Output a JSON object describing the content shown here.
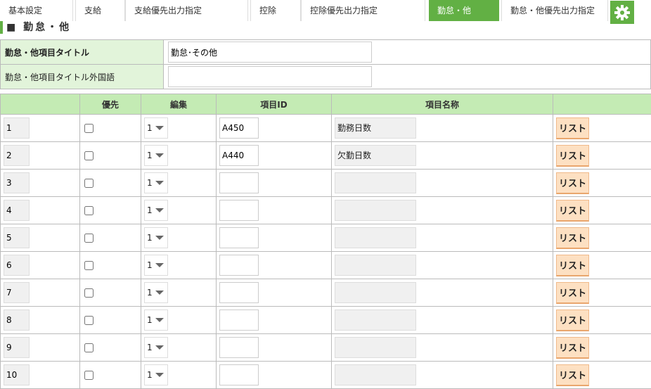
{
  "tabs": [
    "基本設定",
    "支給",
    "支給優先出力指定",
    "控除",
    "控除優先出力指定",
    "勤怠・他",
    "勤怠・他優先出力指定"
  ],
  "active_tab": 5,
  "section_title": "■ 勤怠・他",
  "info": {
    "title_label": "勤怠・他項目タイトル",
    "title_value": "勤怠･その他",
    "foreign_label": "勤怠・他項目タイトル外国語",
    "foreign_value": ""
  },
  "columns": [
    "",
    "優先",
    "編集",
    "項目ID",
    "項目名称",
    ""
  ],
  "rows": [
    {
      "no": "1",
      "edit": "1",
      "id": "A450",
      "name": "勤務日数"
    },
    {
      "no": "2",
      "edit": "1",
      "id": "A440",
      "name": "欠勤日数"
    },
    {
      "no": "3",
      "edit": "1",
      "id": "",
      "name": ""
    },
    {
      "no": "4",
      "edit": "1",
      "id": "",
      "name": ""
    },
    {
      "no": "5",
      "edit": "1",
      "id": "",
      "name": ""
    },
    {
      "no": "6",
      "edit": "1",
      "id": "",
      "name": ""
    },
    {
      "no": "7",
      "edit": "1",
      "id": "",
      "name": ""
    },
    {
      "no": "8",
      "edit": "1",
      "id": "",
      "name": ""
    },
    {
      "no": "9",
      "edit": "1",
      "id": "",
      "name": ""
    },
    {
      "no": "10",
      "edit": "1",
      "id": "",
      "name": ""
    }
  ],
  "list_button": "リスト"
}
